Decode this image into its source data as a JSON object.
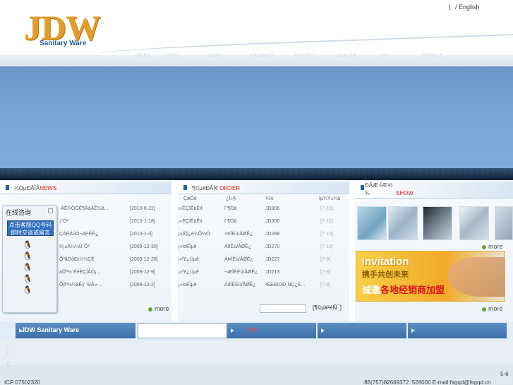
{
  "header": {
    "lang_label": "/ English",
    "logo_text": "JDW",
    "logo_subtitle": "Sanitary Ware",
    "nav": [
      "INDEX",
      "INTRO",
      "NEWS",
      "PRODUCT",
      "PROJECT",
      "DEALER",
      "H.R",
      "SERVICE"
    ]
  },
  "news": {
    "title_prefix": "¼Òµ­ÐÂÎÅ",
    "title_en": "NEWS",
    "items": [
      {
        "text": "·ÀË®ÕÖÊ¶ÂäÄÊ½â...",
        "date": "[2010-6-22]"
      },
      {
        "text": "¡°Ö²",
        "date": "[2010-1-18]"
      },
      {
        "text": "ÇÀÉÁúÖ¬Æ¹ÈÉ¿",
        "date": "[2010-1-3]"
      },
      {
        "text": "©¡±À¼¼Ù¨Õ²",
        "date": "[2009-12-30]"
      },
      {
        "text": "Õ³ãÒõÐ¡¼¼ÇÈ",
        "date": "[2009-12-28]"
      },
      {
        "text": "äÕº½¨ÉèÈÇÌÀÖ¡...",
        "date": "[2009-12-9]"
      },
      {
        "text": "Õõº½¼áÉý ¨ÐÂ»·...",
        "date": "[2009-12-2]"
      }
    ],
    "more": "more"
  },
  "order": {
    "title_prefix": "¶©µ¥ÐÅÏ¢",
    "title_en": "ORDER",
    "columns": [
      "ÇøÓò",
      "¿Í»§",
      "¾­Ïú",
      "Ïµ¼Ý±¼ä"
    ],
    "rows": [
      {
        "c1": "¡«ÉÇÌÊäÊ¢",
        "c2": "Ì¨¶Òã",
        "c3": "JD306",
        "c4": "[7-10]"
      },
      {
        "c1": "¡«ÉÇÌÊäÊ¢",
        "c2": "Ì¨¶Òã",
        "c3": "JD306",
        "c4": "[7-10]"
      },
      {
        "c1": "¡«Ä§¿é¼Õ¼Ö",
        "c2": "×ÞÏÉú/ÂØÊ¿",
        "c3": "JD288",
        "c4": "[7-10]"
      },
      {
        "c1": "¡«ìoÉÌµê",
        "c2": "ÀîÏÈú/ÂØÊ¿",
        "c3": "JD270",
        "c4": "[7-10]"
      },
      {
        "c1": "¡«º£¿Úµê",
        "c2": "ÀÞÏÈú/ÂØÊ¿",
        "c3": "JD227",
        "c4": "[7-9]"
      },
      {
        "c1": "¡«º£¿Úµê",
        "c2": "¬ÆÏÈÉú/ÂØÊ¿",
        "c3": "JD213",
        "c4": "[7-9]"
      },
      {
        "c1": "¡«ìoÉÌµê",
        "c2": "ÁõÏÈÉú/ÂØÊ¿",
        "c3": "²ÉÉÐÍÖÐ¸ÑÇ¿Ê...",
        "c4": "[7-9]"
      }
    ],
    "search_button": "[¶©µ¥²éÑ¯]"
  },
  "show": {
    "title_prefix": "ÐÂÆ·ÍÆ³ö",
    "title_sub": "¾",
    "title_en": "SHOW",
    "more": "more",
    "promo": {
      "invitation": "Invitation",
      "slogan1": "携手共创未来",
      "slogan2_prefix": "诚邀",
      "slogan2_highlight": "各地经销商加盟"
    },
    "bottom_more": "more"
  },
  "chat": {
    "title": "在线咨询",
    "promo": "点击客服QQ号码 即时交谈或留言",
    "agents": 5
  },
  "subnav": {
    "brand": "JDW Sanitary Ware",
    "new_label": "New"
  },
  "footer": {
    "line1": ":",
    "line2": ":",
    "phone_right": "5-6",
    "icp": "ICP 07502320",
    "contact": ":86(757)82669372  :528000  E-mail:fsgqd@fsgqd.cn"
  },
  "colors": {
    "accent": "#3c6fa8",
    "logo": "#e39d2c",
    "highlight": "#e02020",
    "banner": "#7aa6d4"
  }
}
